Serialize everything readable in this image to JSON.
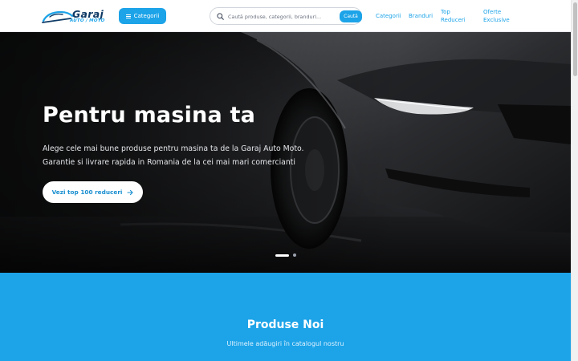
{
  "header": {
    "logo": {
      "main": "Garaj",
      "sub": "AUTO / MOTO"
    },
    "categories_button": "Categorii",
    "search": {
      "placeholder": "Caută produse, categorii, branduri...",
      "value": "",
      "button": "Caută"
    },
    "nav": {
      "categorii": "Categorii",
      "branduri": "Branduri",
      "top_reduceri": "Top Reduceri",
      "oferte_exclusive": "Oferte Exclusive"
    }
  },
  "hero": {
    "title": "Pentru masina ta",
    "subtitle": "Alege cele mai bune produse pentru masina ta de la Garaj Auto Moto. Garantie si livrare rapida in Romania de la cei mai mari comercianti",
    "cta": "Vezi top 100 reduceri",
    "slides": {
      "count": 2,
      "active": 1
    }
  },
  "section": {
    "title": "Produse Noi",
    "subtitle": "Ultimele adăugiri în catalogul nostru"
  },
  "colors": {
    "accent": "#1ca3e8",
    "logo_dark": "#0f3a66",
    "header_bg": "#ffffff",
    "hero_bg": "#151617"
  },
  "icons": {
    "menu": "menu-icon",
    "search": "search-icon",
    "arrow": "arrow-right-icon"
  }
}
